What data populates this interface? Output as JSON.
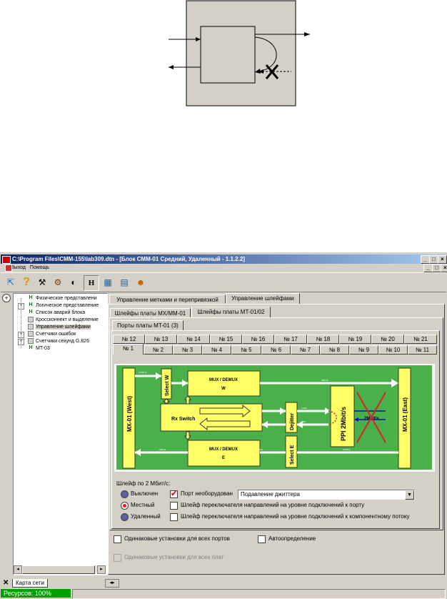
{
  "window": {
    "title": "C:\\Program Files\\CMM-155\\lab309.dtn - [Блок СММ-01 Средний, Удаленный - 1.1.2.2]",
    "min_label": "_",
    "max_label": "□",
    "close_label": "×",
    "restore_label": "ð"
  },
  "menu": {
    "items": [
      "Выход",
      "Помощь"
    ]
  },
  "toolbar": {
    "icons": [
      "exit-icon",
      "help-icon",
      "tools-icon",
      "network-icon",
      "sound-icon",
      "h-button",
      "board-icon",
      "board2-icon",
      "settings-icon"
    ],
    "h_label": "H"
  },
  "tree": {
    "items": [
      {
        "label": "Физическое представлени",
        "icon": "H"
      },
      {
        "label": "Логическое представление",
        "icon": "H"
      },
      {
        "label": "Список аварий блока",
        "icon": "H"
      },
      {
        "label": "Кроссконнект и выделение",
        "icon": ""
      },
      {
        "label": "Управление шлейфами",
        "icon": ""
      },
      {
        "label": "Счетчики ошибок",
        "icon": ""
      },
      {
        "label": "Счетчики секунд G.826",
        "icon": ""
      },
      {
        "label": "MT-03",
        "icon": "H"
      }
    ]
  },
  "tabs": {
    "top": [
      "Управление метками и перепривязкой",
      "Управление шлейфами"
    ],
    "second": [
      "Шлейфы платы MX/MM-01",
      "Шлейфы платы MT-01/02"
    ],
    "third": [
      "Порты платы MT-01 (3)"
    ],
    "ports_row1": [
      "№ 12",
      "№ 13",
      "№ 14",
      "№ 15",
      "№ 16",
      "№ 17",
      "№ 18",
      "№ 19",
      "№ 20",
      "№ 21"
    ],
    "ports_row2": [
      "№ 1",
      "№ 2",
      "№ 3",
      "№ 4",
      "№ 5",
      "№ 6",
      "№ 7",
      "№ 8",
      "№ 9",
      "№ 10",
      "№ 11"
    ]
  },
  "schematic": {
    "mx_west": "MX-01 (West)",
    "mx_east": "MX-01 (East)",
    "select_w": "Select W",
    "select_e": "Select E",
    "mux_w_line1": "MUX / DEMUX",
    "mux_w_line2": "W",
    "mux_e_line1": "MUX / DEMUX",
    "mux_e_line2": "E",
    "rx_switch": "Rx Switch",
    "dejitter": "Dejitter",
    "ppi": "PPI 2Mbit/s",
    "mbits": "2Mbit/s",
    "small_labels": [
      "LPSB W",
      "AB0 W",
      "AB0 W",
      "LPSB E",
      "AB0 E",
      "LPSB",
      "AB0"
    ]
  },
  "loop": {
    "heading": "Шлейф по 2 Мбит/с:",
    "radios": [
      {
        "label": "Выключен",
        "selected": false
      },
      {
        "label": "Местный",
        "selected": true
      },
      {
        "label": "Удаленный",
        "selected": false
      }
    ],
    "port_unequipped": {
      "label": "Порт необорудован",
      "checked": true
    },
    "dropdown_value": "Подавление джиттера",
    "switch_port": {
      "label": "Шлейф переключателя направлений на уровне подключений к порту",
      "checked": false
    },
    "switch_component": {
      "label": "Шлейф переключателя направлений на уровне подключений к компонентному потоку",
      "checked": false
    }
  },
  "bottom": {
    "same_ports": "Одинаковые установки для всех портов",
    "auto_detect": "Автоопределение",
    "same_boards": "Одинаковые установки для всех плат"
  },
  "statusbar": {
    "tab_label": "Карта сети",
    "resources": "Ресурсов: 100%"
  },
  "colors": {
    "accent": "#0a246a",
    "schematic_green": "#4ab04a",
    "block_yellow": "#ffff66",
    "arrow_blue": "#1010c0",
    "cross_red": "#e02020",
    "status_green": "#00a000"
  }
}
